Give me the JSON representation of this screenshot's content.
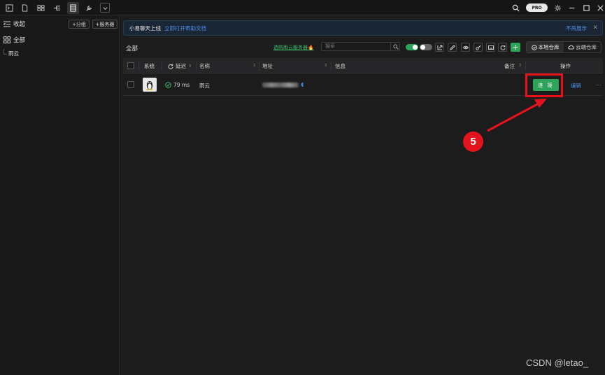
{
  "sidebar": {
    "collapse_label": "收起",
    "add_group_label": "+分组",
    "add_server_label": "+服务器",
    "all_label": "全部",
    "groups": [
      "雨云"
    ]
  },
  "topbar": {
    "pro_badge": "PRO"
  },
  "notice": {
    "text": "小易聊天上线",
    "link": "立即打开帮助文档",
    "dismiss": "不再展示"
  },
  "toolbar": {
    "title": "全部",
    "buy_link": "选购雨云服务器",
    "search_placeholder": "搜索",
    "local_repo": "本地仓库",
    "cloud_repo": "云端仓库",
    "local_selected": true
  },
  "table": {
    "headers": {
      "os": "系统",
      "latency": "延迟",
      "name": "名称",
      "address": "地址",
      "info": "信息",
      "note": "备注",
      "actions": "操作"
    },
    "rows": [
      {
        "os_icon": "linux-penguin-icon",
        "latency": "79 ms",
        "name": "雨云",
        "address": "",
        "info": "",
        "note": "",
        "connect_label": "连 接",
        "edit_label": "编辑",
        "more_label": "..."
      }
    ]
  },
  "annotation": {
    "step_number": "5"
  },
  "watermark": "CSDN @letao_",
  "colors": {
    "accent_green": "#2ea35a",
    "link_blue": "#4d8fe8",
    "annotation_red": "#e3141d"
  }
}
